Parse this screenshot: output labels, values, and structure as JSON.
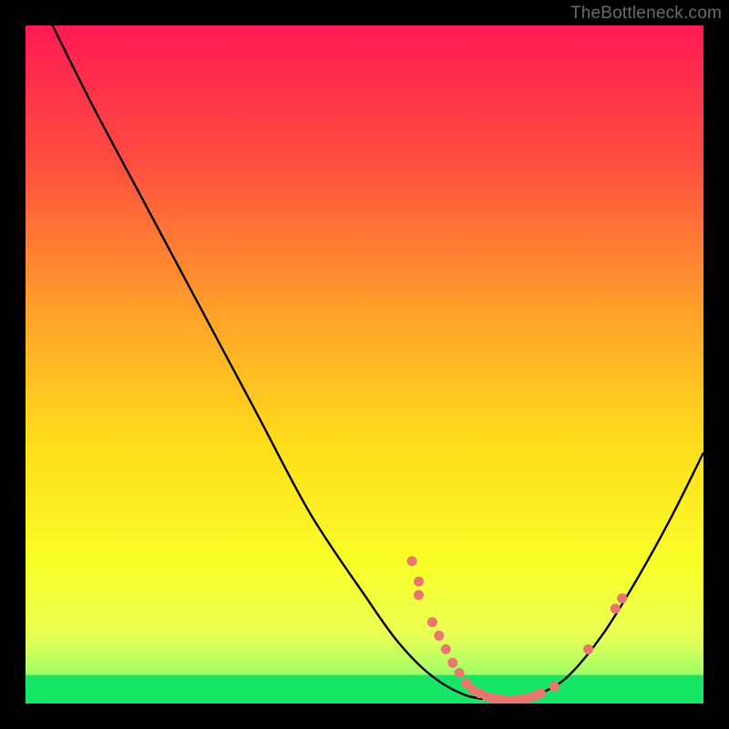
{
  "attribution": "TheBottleneck.com",
  "chart_data": {
    "type": "line",
    "title": "",
    "xlabel": "",
    "ylabel": "",
    "xlim": [
      0,
      100
    ],
    "ylim": [
      0,
      100
    ],
    "curve": [
      {
        "x": 4,
        "y": 100
      },
      {
        "x": 10,
        "y": 88
      },
      {
        "x": 18,
        "y": 73
      },
      {
        "x": 26,
        "y": 58
      },
      {
        "x": 34,
        "y": 43
      },
      {
        "x": 42,
        "y": 28
      },
      {
        "x": 50,
        "y": 16
      },
      {
        "x": 55,
        "y": 9
      },
      {
        "x": 60,
        "y": 4
      },
      {
        "x": 65,
        "y": 1.2
      },
      {
        "x": 70,
        "y": 0.5
      },
      {
        "x": 73,
        "y": 0.5
      },
      {
        "x": 76,
        "y": 1.5
      },
      {
        "x": 80,
        "y": 4
      },
      {
        "x": 85,
        "y": 10
      },
      {
        "x": 90,
        "y": 18
      },
      {
        "x": 95,
        "y": 27
      },
      {
        "x": 100,
        "y": 37
      }
    ],
    "markers": [
      {
        "x": 57,
        "y": 21
      },
      {
        "x": 58,
        "y": 18
      },
      {
        "x": 58,
        "y": 16
      },
      {
        "x": 60,
        "y": 12
      },
      {
        "x": 61,
        "y": 10
      },
      {
        "x": 62,
        "y": 8
      },
      {
        "x": 63,
        "y": 6
      },
      {
        "x": 64,
        "y": 4.5
      },
      {
        "x": 65,
        "y": 3
      },
      {
        "x": 66,
        "y": 2
      },
      {
        "x": 67,
        "y": 1.5
      },
      {
        "x": 68,
        "y": 1
      },
      {
        "x": 69,
        "y": 0.8
      },
      {
        "x": 70,
        "y": 0.6
      },
      {
        "x": 71,
        "y": 0.5
      },
      {
        "x": 72,
        "y": 0.5
      },
      {
        "x": 73,
        "y": 0.6
      },
      {
        "x": 74,
        "y": 0.8
      },
      {
        "x": 75,
        "y": 1.1
      },
      {
        "x": 76,
        "y": 1.5
      },
      {
        "x": 78,
        "y": 2.5
      },
      {
        "x": 83,
        "y": 8
      },
      {
        "x": 87,
        "y": 14
      },
      {
        "x": 88,
        "y": 15.5
      }
    ],
    "gradient_stops": [
      {
        "pct": 0,
        "color": "#ff1a55"
      },
      {
        "pct": 20,
        "color": "#ff4d3f"
      },
      {
        "pct": 42,
        "color": "#ffa02a"
      },
      {
        "pct": 62,
        "color": "#ffdd1a"
      },
      {
        "pct": 80,
        "color": "#f8ff2a"
      },
      {
        "pct": 90,
        "color": "#eaff55"
      },
      {
        "pct": 96,
        "color": "#9cff6a"
      },
      {
        "pct": 100,
        "color": "#17e565"
      }
    ],
    "green_band_top_y": 4.2,
    "marker_color": "#e9776f",
    "curve_color": "#000000"
  }
}
